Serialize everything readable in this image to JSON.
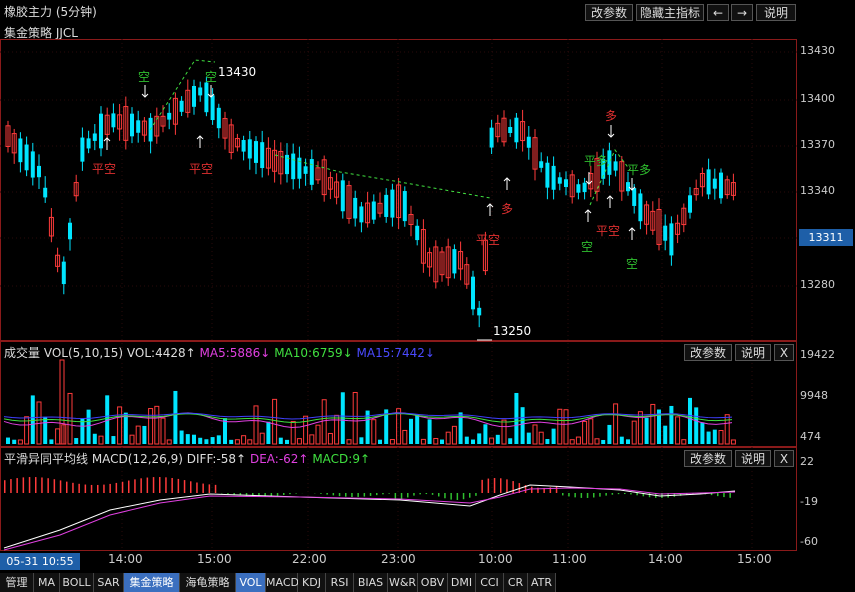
{
  "title": "橡胶主力 (5分钟)",
  "header_buttons": {
    "params": "改参数",
    "hide": "隐藏主指标",
    "left": "←",
    "right": "→",
    "help": "说明"
  },
  "main": {
    "indicator": "集金策略 JJCL",
    "price_ticks": [
      "13430",
      "13400",
      "13370",
      "13340",
      "13310",
      "13280"
    ],
    "current_price": "13311",
    "high_label": "13430",
    "low_label": "13250",
    "signals": [
      {
        "text": "空",
        "color": "#2fbf2f"
      },
      {
        "text": "空",
        "color": "#2fbf2f"
      },
      {
        "text": "平空",
        "color": "#e03030"
      },
      {
        "text": "平空",
        "color": "#e03030"
      },
      {
        "text": "平空",
        "color": "#e03030"
      },
      {
        "text": "多",
        "color": "#e03030"
      },
      {
        "text": "平多",
        "color": "#2fbf2f"
      },
      {
        "text": "多",
        "color": "#e03030"
      },
      {
        "text": "平多",
        "color": "#2fbf2f"
      },
      {
        "text": "平空",
        "color": "#e03030"
      },
      {
        "text": "空",
        "color": "#2fbf2f"
      },
      {
        "text": "空",
        "color": "#2fbf2f"
      }
    ]
  },
  "vol": {
    "label": "成交量 VOL(5,10,15) VOL:4428↑",
    "ma5": "MA5:5886↓",
    "ma10": "MA10:6759↓",
    "ma15": "MA15:7442↓",
    "ticks": [
      "19422",
      "9948",
      "474"
    ],
    "btn_params": "改参数",
    "btn_help": "说明",
    "btn_close": "X"
  },
  "macd": {
    "label": "平滑异同平均线 MACD(12,26,9) DIFF:-58↑",
    "dea": "DEA:-62↑",
    "macd": "MACD:9↑",
    "ticks": [
      "22",
      "-19",
      "-60"
    ],
    "btn_params": "改参数",
    "btn_help": "说明",
    "btn_close": "X"
  },
  "time": {
    "cursor": "05-31 10:55",
    "labels": [
      "14:00",
      "15:00",
      "22:00",
      "23:00",
      "10:00",
      "11:00",
      "14:00",
      "15:00"
    ]
  },
  "tabs": [
    "管理",
    "MA",
    "BOLL",
    "SAR",
    "集金策略",
    "海龟策略",
    "VOL",
    "MACD",
    "KDJ",
    "RSI",
    "BIAS",
    "W&R",
    "OBV",
    "DMI",
    "CCI",
    "CR",
    "ATR"
  ],
  "colors": {
    "up": "#ff3b3b",
    "down": "#00e5ff",
    "ma5": "#e040e0",
    "ma10": "#40e040",
    "ma15": "#4040ff"
  }
}
